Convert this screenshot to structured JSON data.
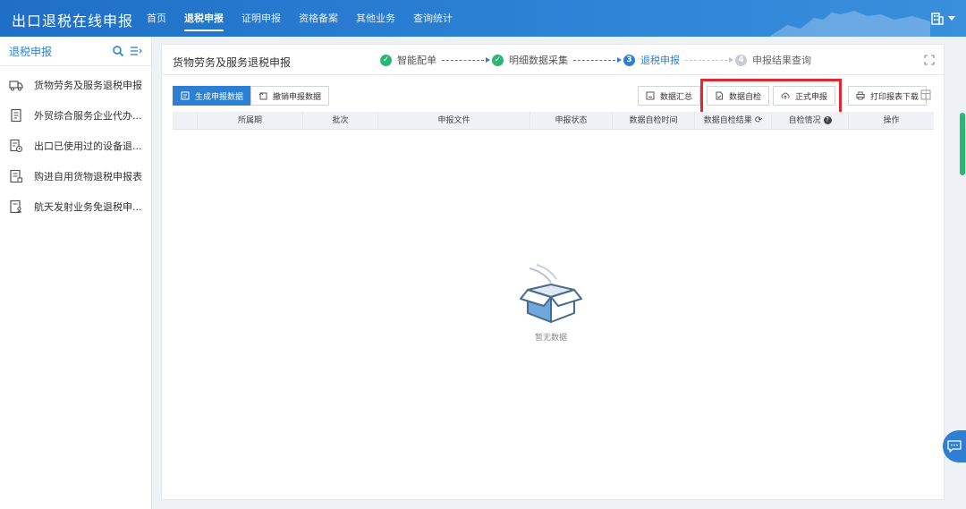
{
  "app": {
    "title": "出口退税在线申报"
  },
  "nav": {
    "items": [
      {
        "label": "首页",
        "active": false
      },
      {
        "label": "退税申报",
        "active": true
      },
      {
        "label": "证明申报",
        "active": false
      },
      {
        "label": "资格备案",
        "active": false
      },
      {
        "label": "其他业务",
        "active": false
      },
      {
        "label": "查询统计",
        "active": false
      }
    ]
  },
  "sidebar": {
    "title": "退税申报",
    "items": [
      {
        "label": "货物劳务及服务退税申报",
        "icon": "truck-icon"
      },
      {
        "label": "外贸综合服务企业代办...",
        "icon": "document-icon"
      },
      {
        "label": "出口已使用过的设备退...",
        "icon": "document-clock-icon"
      },
      {
        "label": "购进自用货物退税申报表",
        "icon": "document-list-icon"
      },
      {
        "label": "航天发射业务免退税申...",
        "icon": "document-person-icon"
      }
    ]
  },
  "main": {
    "page_title": "货物劳务及服务退税申报",
    "steps": [
      {
        "label": "智能配单",
        "status": "done",
        "number": ""
      },
      {
        "label": "明细数据采集",
        "status": "done",
        "number": ""
      },
      {
        "label": "退税申报",
        "status": "current",
        "number": "3"
      },
      {
        "label": "申报结果查询",
        "status": "todo",
        "number": "4"
      }
    ],
    "toolbar": {
      "generate": "生成申报数据",
      "previous": "撤销申报数据",
      "summary": "数据汇总",
      "self_check": "数据自检",
      "formal": "正式申报",
      "print": "打印报表下载"
    },
    "table": {
      "columns": [
        "",
        "所属期",
        "批次",
        "申报文件",
        "申报状态",
        "数据自检时间",
        "数据自检结果",
        "自检情况",
        "操作"
      ]
    },
    "empty_text": "暂无数据"
  },
  "colors": {
    "primary": "#2d7fd3",
    "success": "#2bb673",
    "highlight": "#e0282e"
  }
}
